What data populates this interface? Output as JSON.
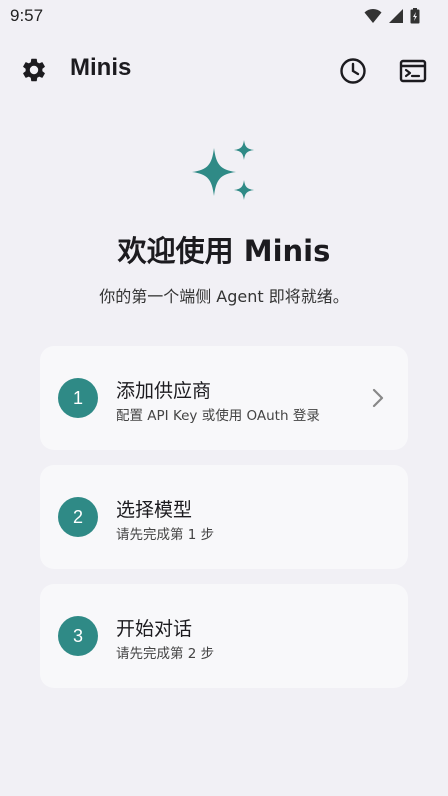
{
  "status_bar": {
    "time": "9:57"
  },
  "app_bar": {
    "title": "Minis"
  },
  "welcome": {
    "title": "欢迎使用 Minis",
    "subtitle": "你的第一个端侧 Agent 即将就绪。"
  },
  "steps": [
    {
      "number": "1",
      "title": "添加供应商",
      "description": "配置 API Key 或使用 OAuth 登录"
    },
    {
      "number": "2",
      "title": "选择模型",
      "description": "请先完成第 1 步"
    },
    {
      "number": "3",
      "title": "开始对话",
      "description": "请先完成第 2 步"
    }
  ],
  "colors": {
    "accent": "#2f8a86",
    "background": "#f1f0f5",
    "card": "#f8f8fa"
  },
  "icons": [
    "wifi-icon",
    "signal-icon",
    "battery-icon",
    "gear-icon",
    "history-icon",
    "terminal-icon",
    "sparkle-icon",
    "chevron-right-icon"
  ]
}
